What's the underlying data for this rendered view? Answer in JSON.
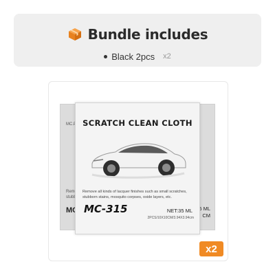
{
  "bundle": {
    "title": "Bundle includes",
    "icon": "box-icon",
    "item": {
      "label": "Black 2pcs",
      "quantity": "x2"
    }
  },
  "product": {
    "name": "SCRATCH CLEAN CLOTH",
    "description": "Remove all kinds of lacquer finishes such as small scratches, stubborn stains, mosquito corpses, oxide layers, etc.",
    "model": "MC-315",
    "net": "NET:35 ML",
    "size": "2PCS/10X10CM/3.94X3.94cm",
    "back_left_top": "MC.P",
    "back_left_mid": "Remo",
    "back_left_mid2": "stubbo",
    "back_left_model": "MC",
    "back_right_net": "5 ML",
    "back_right_cm": "CM",
    "badge": "x2"
  },
  "colors": {
    "accent": "#f08a24",
    "panel": "#efefef"
  }
}
